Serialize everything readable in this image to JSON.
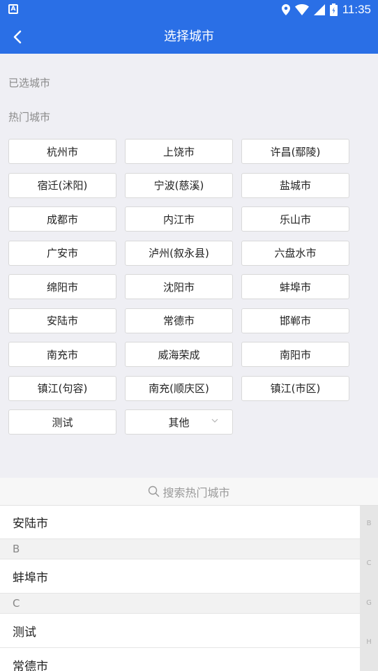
{
  "status_bar": {
    "time": "11:35",
    "app_glyph": "A"
  },
  "nav": {
    "title": "选择城市"
  },
  "sections": {
    "selected_label": "已选城市",
    "hot_label": "热门城市"
  },
  "hot_cities": [
    "杭州市",
    "上饶市",
    "许昌(鄢陵)",
    "宿迁(沭阳)",
    "宁波(慈溪)",
    "盐城市",
    "成都市",
    "内江市",
    "乐山市",
    "广安市",
    "泸州(叙永县)",
    "六盘水市",
    "绵阳市",
    "沈阳市",
    "蚌埠市",
    "安陆市",
    "常德市",
    "邯郸市",
    "南充市",
    "威海荣成",
    "南阳市",
    "镇江(句容)",
    "南充(顺庆区)",
    "镇江(市区)",
    "测试",
    "其他"
  ],
  "search": {
    "placeholder": "搜索热门城市"
  },
  "list": {
    "row_0": "安陆市",
    "group_b": "B",
    "row_1": "蚌埠市",
    "group_c": "C",
    "row_2": "测试",
    "row_3": "常德市"
  },
  "index_letters": [
    "B",
    "C",
    "G",
    "H"
  ],
  "colors": {
    "accent": "#2a6fe6",
    "background": "#efeff4"
  }
}
